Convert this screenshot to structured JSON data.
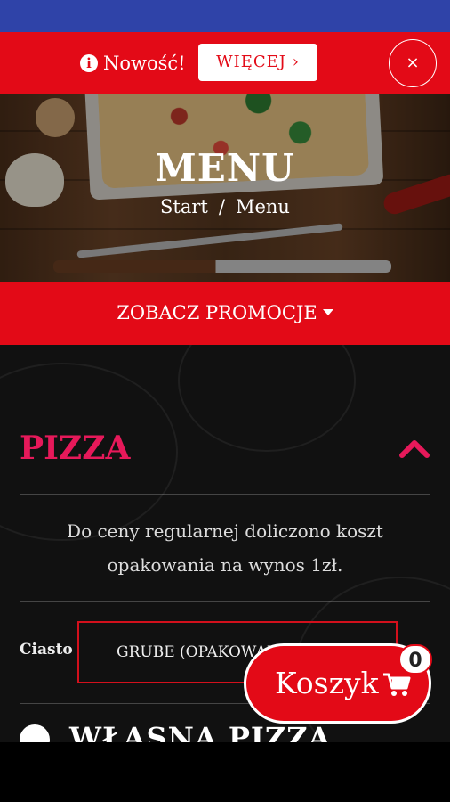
{
  "notice": {
    "text": "Nowość!",
    "more_label": "WIĘCEJ ›",
    "close_label": "×"
  },
  "hero": {
    "title": "MENU",
    "breadcrumb": [
      "Start",
      "/",
      "Menu"
    ]
  },
  "promo": {
    "label": "ZOBACZ PROMOCJE"
  },
  "section": {
    "title": "PIZZA",
    "note": "Do ceny regularnej doliczono koszt opakowania na wynos 1zł."
  },
  "options": {
    "crust_label": "Ciasto",
    "crust_value": "GRUBE (OPAKOWANIE"
  },
  "item": {
    "title": "WŁASNA PIZZA"
  },
  "cart": {
    "label": "Koszyk",
    "count": "0"
  },
  "colors": {
    "brand_red": "#e30a17",
    "accent_pink": "#e6195a",
    "status_blue": "#2f43a8"
  }
}
